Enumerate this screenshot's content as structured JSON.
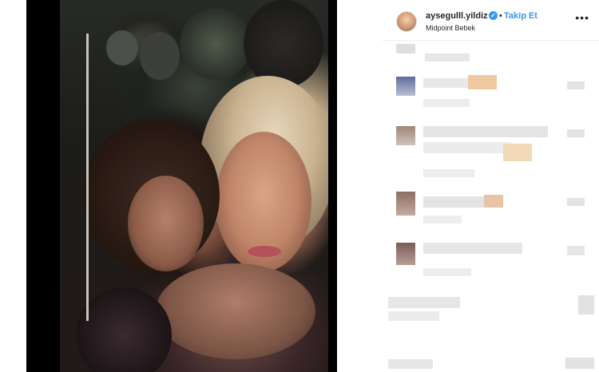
{
  "post": {
    "author": {
      "username": "aysegulll.yildiz",
      "verified_icon": "verified-badge-icon",
      "separator": "•",
      "follow_label": "Takip Et",
      "location": "Midpoint Bebek"
    },
    "more_options_icon": "more-horizontal-icon",
    "more_label": "•••",
    "colors": {
      "link_blue": "#3897f0",
      "text_dark": "#262626",
      "divider": "#efefef"
    }
  }
}
